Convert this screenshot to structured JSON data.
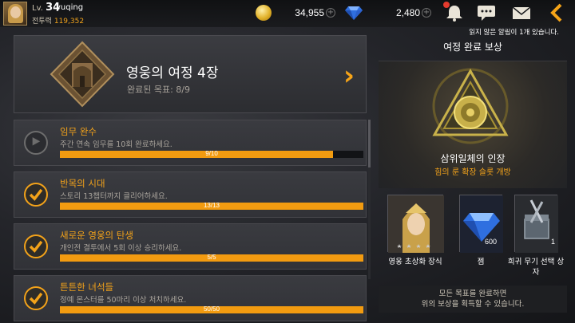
{
  "player": {
    "level_prefix": "Lv.",
    "level": "34",
    "name": "yuqing",
    "power_label": "전투력",
    "power_value": "119,352"
  },
  "currency": {
    "gold": "34,955",
    "gems": "2,480"
  },
  "notice": {
    "text": "읽지 않은 알림이 1개 있습니다."
  },
  "chapter": {
    "title": "영웅의 여정 4장",
    "progress_label": "완료된 목표: 8/9"
  },
  "quests": [
    {
      "title": "임무 완수",
      "desc": "주간 연속 임무를 10회 완료하세요.",
      "progress": "9/10",
      "fraction": 0.9,
      "done": false
    },
    {
      "title": "반목의 시대",
      "desc": "스토리 13챕터까지 클리어하세요.",
      "progress": "13/13",
      "fraction": 1.0,
      "done": true
    },
    {
      "title": "새로운 영웅의 탄생",
      "desc": "개인전 결투에서 5회 이상 승리하세요.",
      "progress": "5/5",
      "fraction": 1.0,
      "done": true
    },
    {
      "title": "튼튼한 녀석들",
      "desc": "정예 몬스터를 50마리 이상 처치하세요.",
      "progress": "50/50",
      "fraction": 1.0,
      "done": true
    }
  ],
  "reward": {
    "header": "여정 완료 보상",
    "main_name": "삼위일체의 인장",
    "main_sub": "힘의 룬 확장 슬롯 개방",
    "items": [
      {
        "label": "영웅 초상화 장식",
        "qty": ""
      },
      {
        "label": "젬",
        "qty": "600"
      },
      {
        "label": "희귀 무기 선택 상자",
        "qty": "1"
      }
    ],
    "footer_line1": "모든 목표를 완료하면",
    "footer_line2": "위의 보상을 획득할 수 있습니다."
  },
  "colors": {
    "accent": "#f2a21a",
    "bar_fill": "#f29b10",
    "badge": "#e53b2e"
  }
}
